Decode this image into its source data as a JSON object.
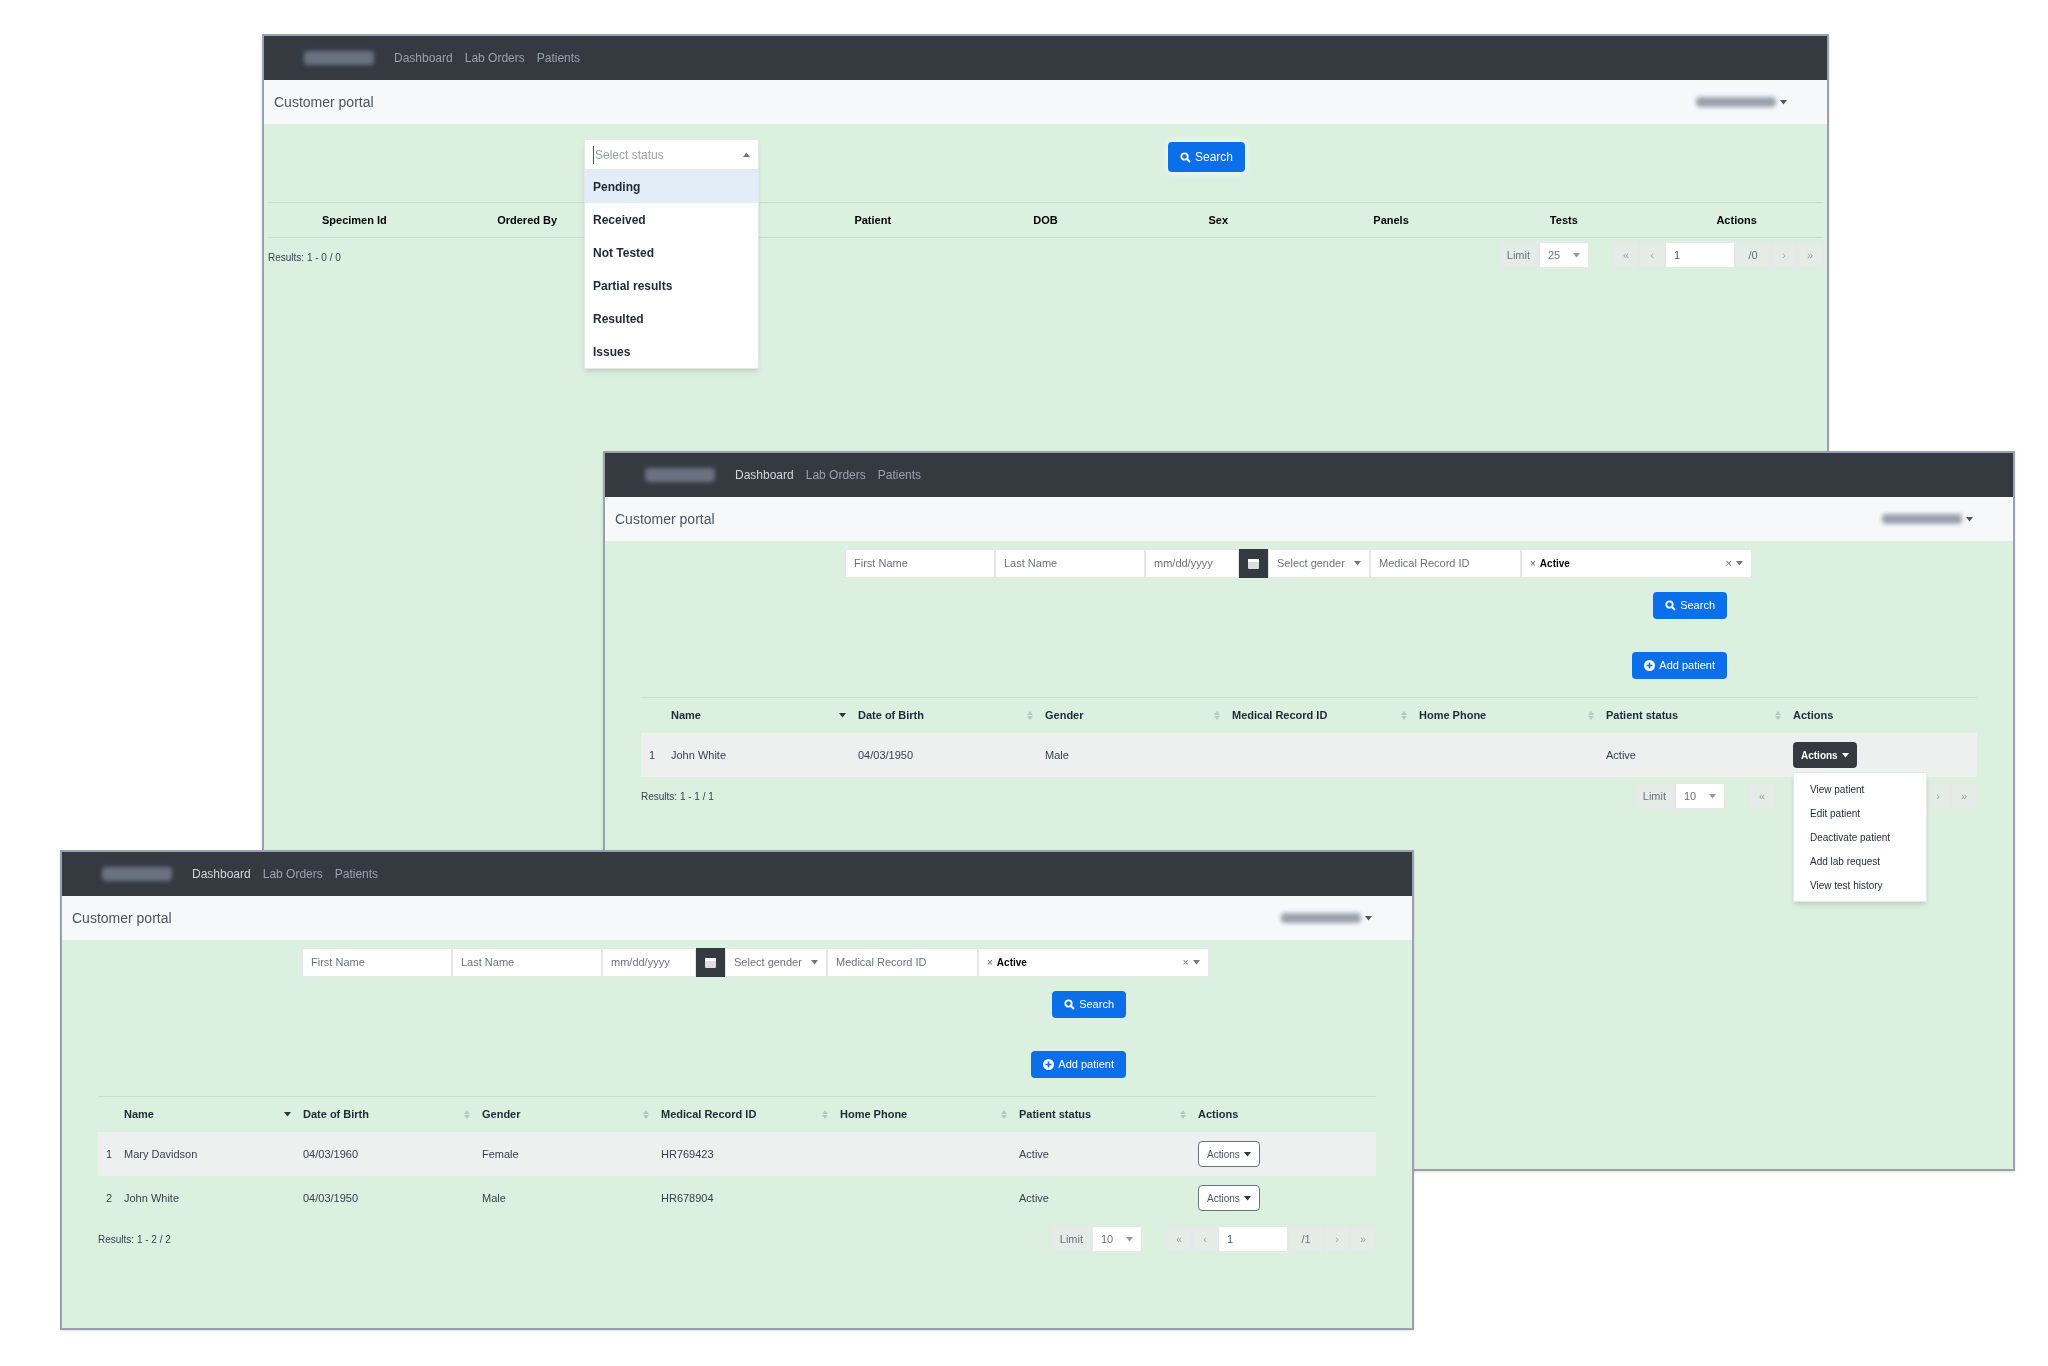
{
  "windows": [
    {
      "kind": "lab_orders",
      "nav": [
        "Dashboard",
        "Lab Orders",
        "Patients"
      ],
      "title": "Customer portal",
      "status_select": {
        "placeholder": "Select status",
        "expanded": true,
        "options": [
          {
            "label": "Pending",
            "selected": true
          },
          {
            "label": "Received",
            "selected": false
          },
          {
            "label": "Not Tested",
            "selected": false
          },
          {
            "label": "Partial results",
            "selected": false
          },
          {
            "label": "Resulted",
            "selected": false
          },
          {
            "label": "Issues",
            "selected": false
          }
        ]
      },
      "search_button": "Search",
      "columns": [
        "Specimen Id",
        "Ordered By",
        "Patient",
        "DOB",
        "Sex",
        "Panels",
        "Tests",
        "Actions"
      ],
      "results": "Results: 1 - 0 / 0",
      "pagination": {
        "limit_label": "Limit",
        "limit": "25",
        "first": "«",
        "prev": "‹",
        "page": "1",
        "total": "/0",
        "next": "›",
        "last": "»"
      }
    },
    {
      "kind": "patients",
      "nav": [
        "Dashboard",
        "Lab Orders",
        "Patients"
      ],
      "title": "Customer portal",
      "filters": {
        "first_name": "First Name",
        "last_name": "Last Name",
        "dob": "mm/dd/yyyy",
        "gender": "Select gender",
        "mrn": "Medical Record ID",
        "status_tag": "Active",
        "tag_remove": "×",
        "clear": "×"
      },
      "search_button": "Search",
      "add_button": "Add patient",
      "columns": [
        {
          "label": "Name",
          "sorted": true
        },
        {
          "label": "Date of Birth",
          "sorted": false
        },
        {
          "label": "Gender",
          "sorted": false
        },
        {
          "label": "Medical Record ID",
          "sorted": false
        },
        {
          "label": "Home Phone",
          "sorted": false
        },
        {
          "label": "Patient status",
          "sorted": false
        },
        {
          "label": "Actions"
        }
      ],
      "rows": [
        {
          "index": "1",
          "name": "John White",
          "dob": "04/03/1950",
          "gender": "Male",
          "status": "Active",
          "actions": "Actions",
          "expanded": true
        }
      ],
      "menu": [
        "View patient",
        "Edit patient",
        "Deactivate patient",
        "Add lab request",
        "View test history"
      ],
      "results": "Results: 1 - 1 / 1",
      "pagination": {
        "limit_label": "Limit",
        "limit": "10",
        "first": "«",
        "next": "›",
        "last": "»"
      }
    },
    {
      "kind": "patients",
      "nav": [
        "Dashboard",
        "Lab Orders",
        "Patients"
      ],
      "title": "Customer portal",
      "filters": {
        "first_name": "First Name",
        "last_name": "Last Name",
        "dob": "mm/dd/yyyy",
        "gender": "Select gender",
        "mrn": "Medical Record ID",
        "status_tag": "Active",
        "tag_remove": "×",
        "clear": "×"
      },
      "search_button": "Search",
      "add_button": "Add patient",
      "columns": [
        {
          "label": "Name",
          "sorted": true
        },
        {
          "label": "Date of Birth",
          "sorted": false
        },
        {
          "label": "Gender",
          "sorted": false
        },
        {
          "label": "Medical Record ID",
          "sorted": false
        },
        {
          "label": "Home Phone",
          "sorted": false
        },
        {
          "label": "Patient status",
          "sorted": false
        },
        {
          "label": "Actions"
        }
      ],
      "rows": [
        {
          "index": "1",
          "name": "Mary Davidson",
          "dob": "04/03/1960",
          "gender": "Female",
          "mrn": "HR769423",
          "status": "Active",
          "actions": "Actions",
          "expanded": false
        },
        {
          "index": "2",
          "name": "John White",
          "dob": "04/03/1950",
          "gender": "Male",
          "mrn": "HR678904",
          "status": "Active",
          "actions": "Actions",
          "expanded": false
        }
      ],
      "results": "Results: 1 - 2 / 2",
      "pagination": {
        "limit_label": "Limit",
        "limit": "10",
        "first": "«",
        "prev": "‹",
        "page": "1",
        "total": "/1",
        "next": "›",
        "last": "»"
      }
    }
  ]
}
